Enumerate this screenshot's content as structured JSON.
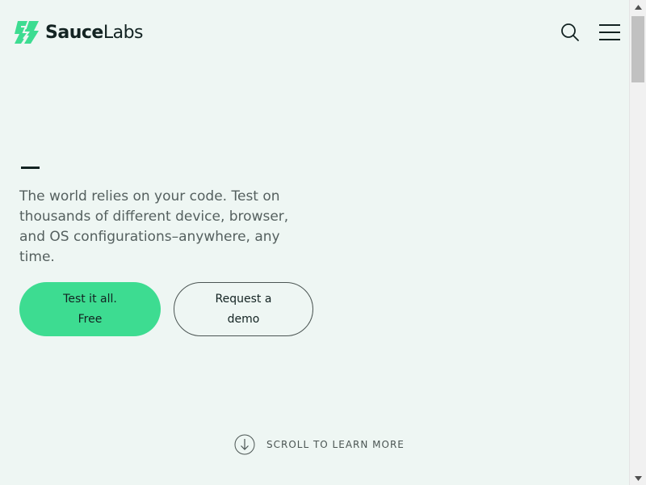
{
  "header": {
    "logo_bold": "Sauce",
    "logo_light": "Labs",
    "logo_icon": "saucelabs-bolt-icon",
    "search_icon": "search-icon",
    "menu_icon": "hamburger-menu-icon"
  },
  "hero": {
    "tagline": "The world relies on your code. Test on thousands of different device, browser, and OS configurations–anywhere, any time.",
    "primary_button": "Test it all. Free",
    "secondary_button": "Request a demo"
  },
  "scroll_prompt": {
    "label": "SCROLL TO LEARN MORE",
    "icon": "arrow-down-circle-icon"
  },
  "colors": {
    "background": "#eef6f3",
    "brand_green": "#3ddc91",
    "text_dark": "#132322",
    "text_muted": "#55605f"
  }
}
